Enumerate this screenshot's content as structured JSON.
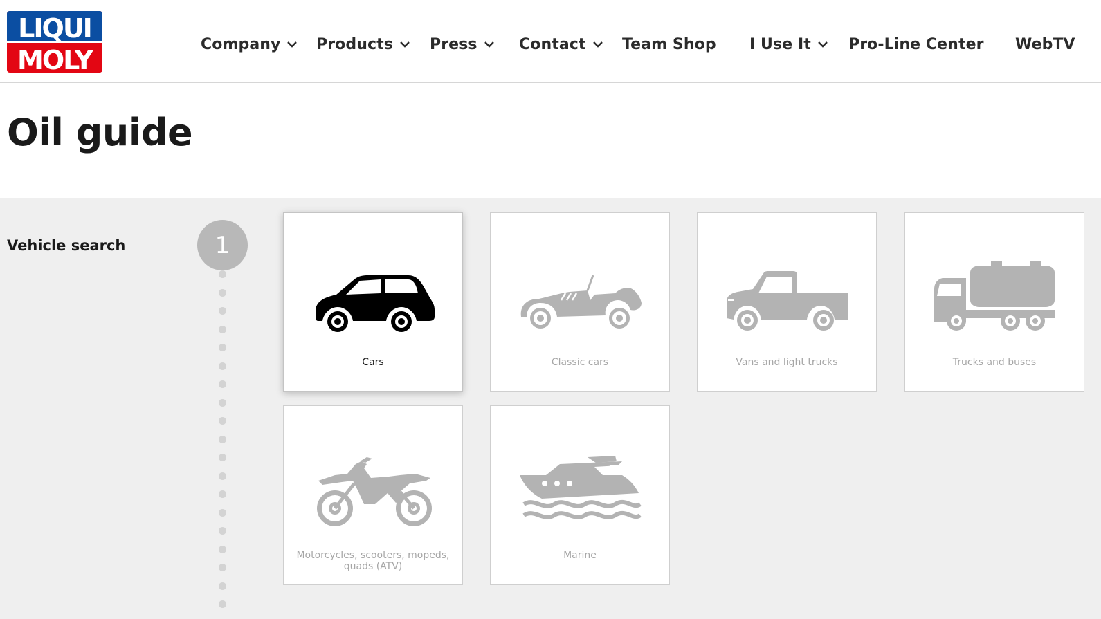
{
  "brand": {
    "logo_line1": "LIQUI",
    "logo_line2": "MOLY",
    "blue": "#0b4ea2",
    "red": "#e30613"
  },
  "nav": [
    {
      "label": "Company",
      "dropdown": true
    },
    {
      "label": "Products",
      "dropdown": true
    },
    {
      "label": "Press",
      "dropdown": true
    },
    {
      "label": "Contact",
      "dropdown": true
    },
    {
      "label": "Team Shop",
      "dropdown": false
    },
    {
      "label": "I Use It",
      "dropdown": true
    },
    {
      "label": "Pro-Line Center",
      "dropdown": false
    },
    {
      "label": "WebTV",
      "dropdown": false
    }
  ],
  "page": {
    "title": "Oil guide"
  },
  "search": {
    "section_label": "Vehicle search",
    "step_number": "1",
    "vehicles": [
      {
        "label": "Cars",
        "icon": "car-icon",
        "selected": true
      },
      {
        "label": "Classic cars",
        "icon": "classic-car-icon",
        "selected": false
      },
      {
        "label": "Vans and light trucks",
        "icon": "pickup-truck-icon",
        "selected": false
      },
      {
        "label": "Trucks and buses",
        "icon": "tanker-truck-icon",
        "selected": false
      },
      {
        "label": "Motorcycles, scooters, mopeds, quads (ATV)",
        "icon": "motorcycle-icon",
        "selected": false
      },
      {
        "label": "Marine",
        "icon": "boat-icon",
        "selected": false
      }
    ]
  },
  "colors": {
    "icon_active": "#000000",
    "icon_inactive": "#b3b3b3",
    "panel_bg": "#efefef"
  }
}
